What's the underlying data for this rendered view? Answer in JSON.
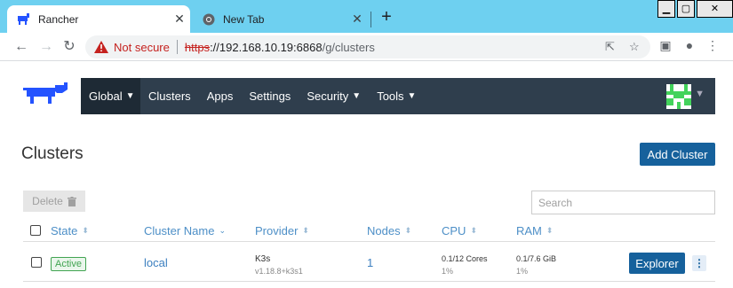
{
  "browser": {
    "tabs": [
      {
        "title": "Rancher",
        "icon": "rancher-favicon"
      },
      {
        "title": "New Tab",
        "icon": "chrome-icon"
      }
    ],
    "security_label": "Not secure",
    "url_scheme": "https",
    "url_host": "://192.168.10.19:6868",
    "url_path": "/g/clusters"
  },
  "nav": {
    "items": [
      {
        "label": "Global",
        "chevron": true
      },
      {
        "label": "Clusters",
        "chevron": false
      },
      {
        "label": "Apps",
        "chevron": false
      },
      {
        "label": "Settings",
        "chevron": false
      },
      {
        "label": "Security",
        "chevron": true
      },
      {
        "label": "Tools",
        "chevron": true
      }
    ],
    "bar_color": "#2f3e4d",
    "active_color": "#1e2a35"
  },
  "page": {
    "title": "Clusters",
    "add_button": "Add Cluster",
    "delete_button": "Delete",
    "search_placeholder": "Search",
    "accent": "#16619c"
  },
  "table": {
    "columns": [
      "State",
      "Cluster Name",
      "Provider",
      "Nodes",
      "CPU",
      "RAM"
    ],
    "rows": [
      {
        "state": "Active",
        "name": "local",
        "provider": "K3s",
        "provider_version": "v1.18.8+k3s1",
        "nodes": "1",
        "cpu": "0.1/12 Cores",
        "cpu_pct": "1%",
        "ram": "0.1/7.6 GiB",
        "ram_pct": "1%",
        "action": "Explorer"
      }
    ]
  }
}
